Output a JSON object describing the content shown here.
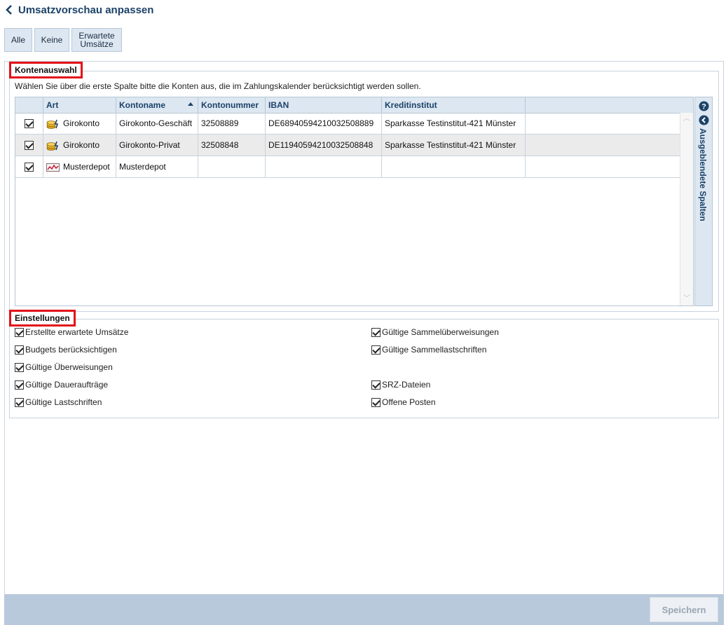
{
  "header": {
    "title": "Umsatzvorschau anpassen",
    "back_icon": "chevron-left-icon"
  },
  "filter_buttons": [
    {
      "label": "Alle"
    },
    {
      "label": "Keine"
    },
    {
      "label_line1": "Erwartete",
      "label_line2": "Umsätze"
    }
  ],
  "konten": {
    "legend": "Kontenauswahl",
    "hint": "Wählen Sie über die erste Spalte bitte die Konten aus, die im Zahlungskalender berücksichtigt werden sollen.",
    "columns": [
      "Art",
      "Kontoname",
      "Kontonummer",
      "IBAN",
      "Kreditinstitut"
    ],
    "sorted_column": "Kontoname",
    "rows": [
      {
        "checked": true,
        "art": "Girokonto",
        "icon": "coins-icon",
        "kontoname": "Girokonto-Geschäft",
        "kontonummer": "32508889",
        "iban": "DE68940594210032508889",
        "kreditinstitut": "Sparkasse Testinstitut-421 Münster"
      },
      {
        "checked": true,
        "art": "Girokonto",
        "icon": "coins-icon",
        "kontoname": "Girokonto-Privat",
        "kontonummer": "32508848",
        "iban": "DE11940594210032508848",
        "kreditinstitut": "Sparkasse Testinstitut-421 Münster"
      },
      {
        "checked": true,
        "art": "Musterdepot",
        "icon": "depot-chart-icon",
        "kontoname": "Musterdepot",
        "kontonummer": "",
        "iban": "",
        "kreditinstitut": ""
      }
    ],
    "side_panel_label": "Ausgeblendete Spalten"
  },
  "einstellungen": {
    "legend": "Einstellungen",
    "left": [
      {
        "label": "Erstellte erwartete Umsätze",
        "checked": true
      },
      {
        "label": "Budgets berücksichtigen",
        "checked": true
      },
      {
        "label": "Gültige Überweisungen",
        "checked": true
      },
      {
        "label": "Gültige Daueraufträge",
        "checked": true
      },
      {
        "label": "Gültige Lastschriften",
        "checked": true
      }
    ],
    "right": [
      {
        "label": "Gültige Sammelüberweisungen",
        "checked": true
      },
      {
        "label": "Gültige Sammellastschriften",
        "checked": true
      },
      {
        "label": "SRZ-Dateien",
        "checked": true
      },
      {
        "label": "Offene Posten",
        "checked": true
      }
    ]
  },
  "footer": {
    "save_label": "Speichern"
  },
  "colors": {
    "accent": "#1c4268",
    "highlight": "#e3101a",
    "header_bg": "#dce7f2",
    "footer_bg": "#b9c9dc"
  }
}
